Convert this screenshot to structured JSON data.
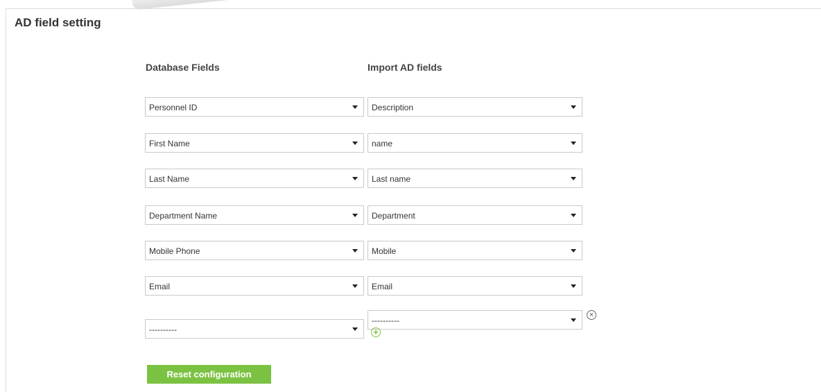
{
  "section": {
    "title": "AD field setting"
  },
  "columns": {
    "database_header": "Database Fields",
    "import_header": "Import AD fields"
  },
  "mappings": [
    {
      "database": "Personnel ID",
      "ad": "Description"
    },
    {
      "database": "First Name",
      "ad": "name"
    },
    {
      "database": "Last Name",
      "ad": "Last name"
    },
    {
      "database": "Department Name",
      "ad": "Department"
    },
    {
      "database": "Mobile Phone",
      "ad": "Mobile"
    },
    {
      "database": "Email",
      "ad": "Email"
    },
    {
      "database": "----------",
      "ad": "----------"
    }
  ],
  "icons": {
    "remove": "close-circle-icon",
    "add": "plus-circle-icon",
    "dropdown": "chevron-down-icon"
  },
  "buttons": {
    "reset_label": "Reset configuration"
  },
  "colors": {
    "accent": "#7cc242",
    "border": "#c9c9c9"
  }
}
